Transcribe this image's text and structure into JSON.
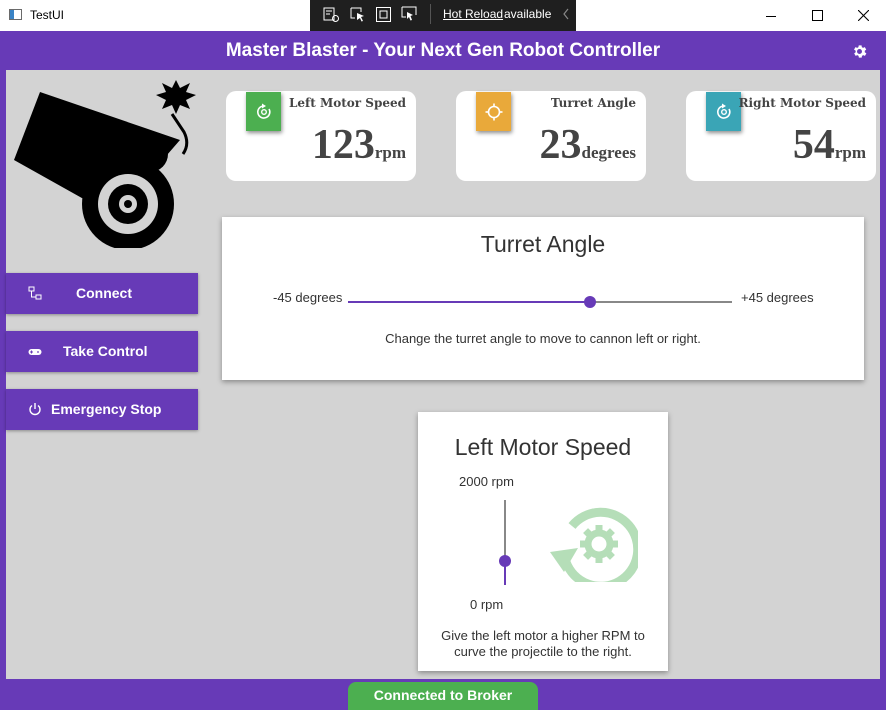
{
  "window": {
    "title": "TestUI",
    "devtools": {
      "hot_reload_link": "Hot Reload",
      "hot_reload_text": "available"
    }
  },
  "header": {
    "title": "Master Blaster - Your Next Gen Robot Controller"
  },
  "nav": [
    {
      "label": "Connect",
      "icon": "network-icon"
    },
    {
      "label": "Take Control",
      "icon": "gamepad-icon"
    },
    {
      "label": "Emergency Stop",
      "icon": "power-icon"
    }
  ],
  "cards": [
    {
      "title": "Left Motor Speed",
      "value": "123",
      "unit": "rpm",
      "color": "#4caf50",
      "icon": "motor-rotate-icon"
    },
    {
      "title": "Turret Angle",
      "value": "23",
      "unit": "degrees",
      "color": "#e9a93a",
      "icon": "crosshair-icon"
    },
    {
      "title": "Right Motor Speed",
      "value": "54",
      "unit": "rpm",
      "color": "#3aa5b6",
      "icon": "motor-rotate-icon"
    }
  ],
  "turret": {
    "title": "Turret Angle",
    "min_label": "-45 degrees",
    "max_label": "+45 degrees",
    "value_fraction": 0.63,
    "description": "Change the turret angle to move to cannon left or right."
  },
  "left_motor": {
    "title": "Left Motor Speed",
    "max_label": "2000 rpm",
    "min_label": "0 rpm",
    "value_fraction": 0.28,
    "description": "Give the left motor a higher RPM to curve the projectile to the right."
  },
  "status": {
    "text": "Connected to Broker"
  },
  "colors": {
    "primary": "#673ab7",
    "status_green": "#4caf50",
    "panel_bg": "#d3d3d3"
  }
}
